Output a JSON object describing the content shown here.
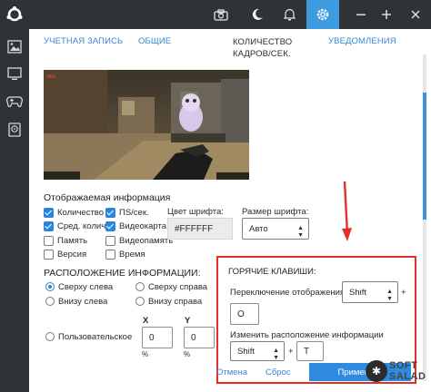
{
  "tabs": {
    "account": "УЧЕТНАЯ ЗАПИСЬ",
    "general": "ОБЩИЕ",
    "fps_line1": "КОЛИЧЕСТВО",
    "fps_line2": "КАДРОВ/СЕК.",
    "notifications": "УВЕДОМЛЕНИЯ"
  },
  "info": {
    "heading": "Отображаемая информация",
    "checkboxes": [
      {
        "label": "Количество к",
        "checked": true
      },
      {
        "label": "ПS/сек.",
        "checked": true
      },
      {
        "label": "Сред. количе",
        "checked": true
      },
      {
        "label": "Видеокарта",
        "checked": true
      },
      {
        "label": "Память",
        "checked": false
      },
      {
        "label": "Видеопамять",
        "checked": false
      },
      {
        "label": "Версия",
        "checked": false
      },
      {
        "label": "Время",
        "checked": false
      }
    ],
    "font_color_label": "Цвет шрифта:",
    "font_color_value": "#FFFFFF",
    "font_size_label": "Размер шрифта:",
    "font_size_value": "Авто"
  },
  "position": {
    "heading": "РАСПОЛОЖЕНИЕ ИНФОРМАЦИИ:",
    "options": [
      {
        "label": "Сверху слева",
        "selected": true
      },
      {
        "label": "Сверху справа",
        "selected": false
      },
      {
        "label": "Внизу слева",
        "selected": false
      },
      {
        "label": "Внизу справа",
        "selected": false
      },
      {
        "label": "Пользовательское",
        "selected": false
      }
    ],
    "x_label": "X",
    "y_label": "Y",
    "x_value": "0",
    "y_value": "0",
    "unit": "%"
  },
  "hotkeys": {
    "heading": "ГОРЯЧИЕ КЛАВИШИ:",
    "toggle_label": "Переключение отображения",
    "toggle_modifier": "Shift",
    "plus": "+",
    "toggle_key": "O",
    "move_label": "Изменить расположение информации",
    "move_modifier": "Shift",
    "move_key": "T"
  },
  "footer": {
    "cancel": "Отмена",
    "reset": "Сброс",
    "apply": "Применить"
  },
  "watermark": {
    "line1": "SOFT",
    "line2": "SALAD"
  },
  "colors": {
    "accent": "#3e9be0",
    "highlight": "#e4302b",
    "chrome": "#2f3237"
  }
}
